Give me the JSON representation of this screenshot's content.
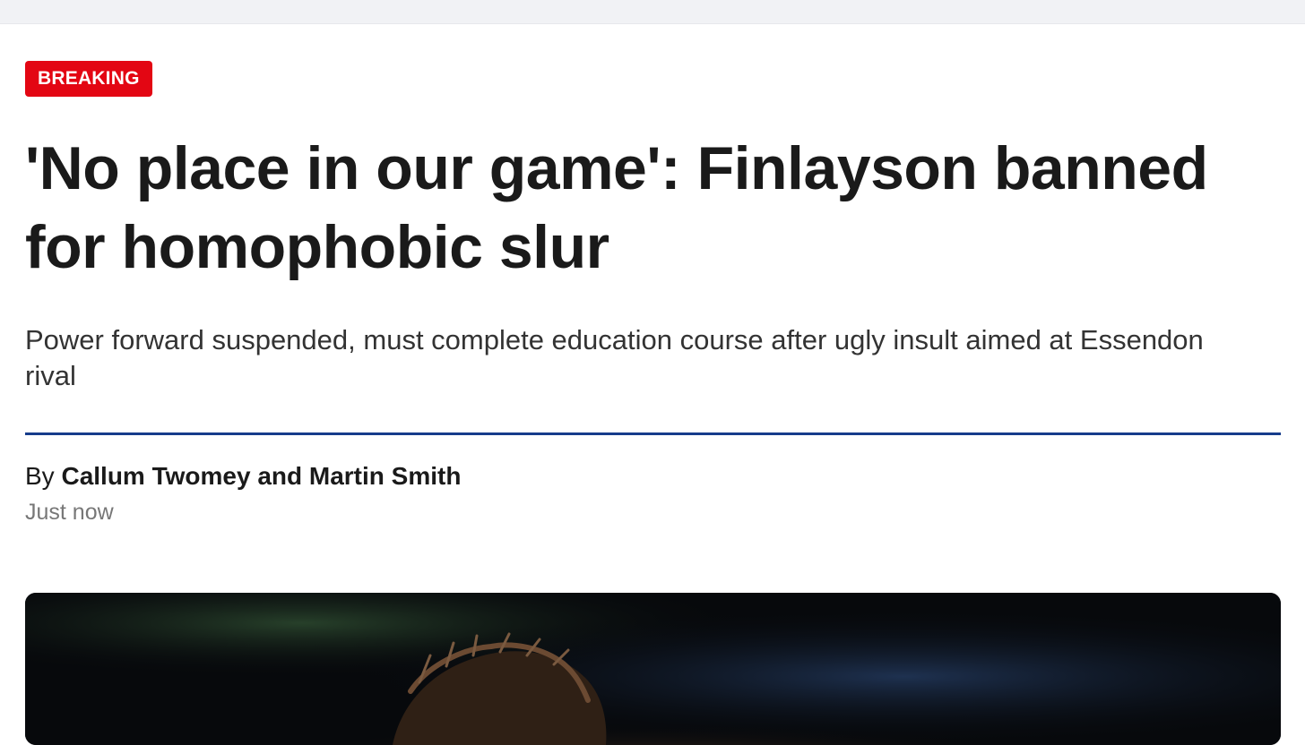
{
  "article": {
    "badge": "BREAKING",
    "headline": "'No place in our game': Finlayson banned for homophobic slur",
    "standfirst": "Power forward suspended, must complete education course after ugly insult aimed at Essendon rival",
    "byline_prefix": "By",
    "authors": "Callum Twomey and Martin Smith",
    "timestamp": "Just now"
  },
  "colors": {
    "badge": "#e30613",
    "rule": "#163c8b",
    "headline": "#1a1a1a",
    "timestamp": "#777777"
  }
}
